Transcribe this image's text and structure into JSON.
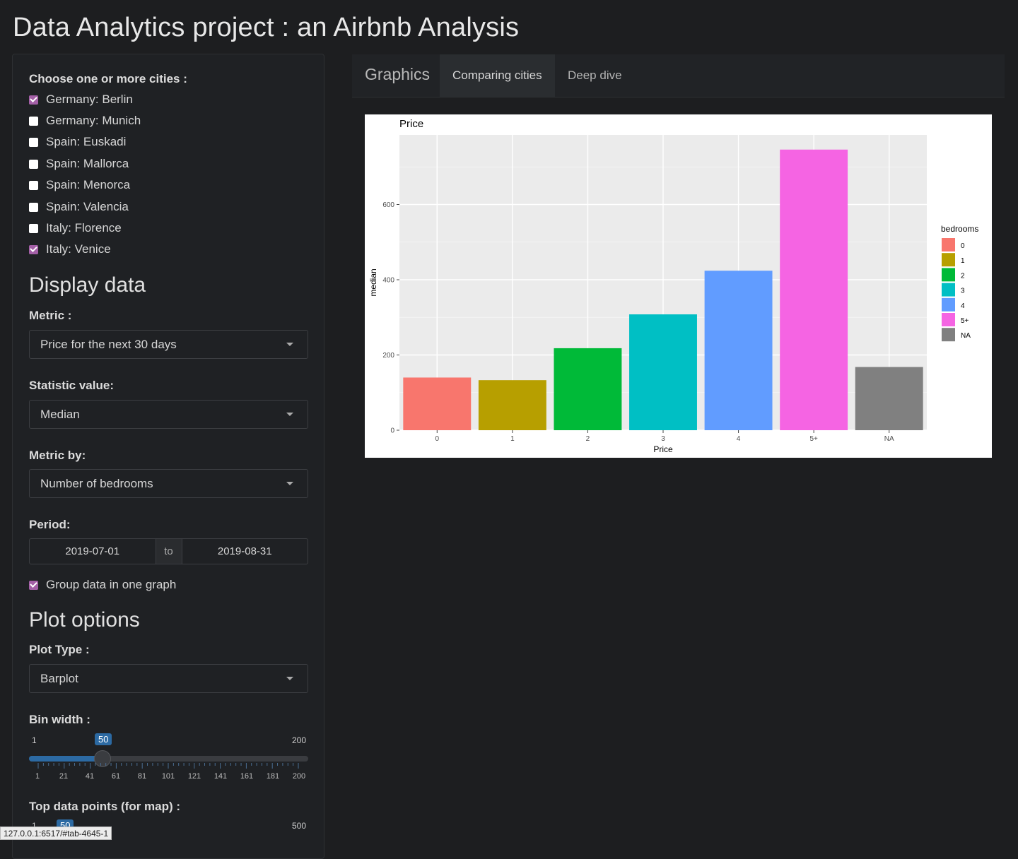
{
  "title": "Data Analytics project : an Airbnb Analysis",
  "sidebar": {
    "cities_label": "Choose one or more cities :",
    "cities": [
      {
        "label": "Germany: Berlin",
        "checked": true
      },
      {
        "label": "Germany: Munich",
        "checked": false
      },
      {
        "label": "Spain: Euskadi",
        "checked": false
      },
      {
        "label": "Spain: Mallorca",
        "checked": false
      },
      {
        "label": "Spain: Menorca",
        "checked": false
      },
      {
        "label": "Spain: Valencia",
        "checked": false
      },
      {
        "label": "Italy: Florence",
        "checked": false
      },
      {
        "label": "Italy: Venice",
        "checked": true
      }
    ],
    "display_heading": "Display data",
    "metric_label": "Metric :",
    "metric_value": "Price for the next 30 days",
    "statistic_label": "Statistic value:",
    "statistic_value": "Median",
    "metric_by_label": "Metric by:",
    "metric_by_value": "Number of bedrooms",
    "period_label": "Period:",
    "period_start": "2019-07-01",
    "period_sep": "to",
    "period_end": "2019-08-31",
    "group_label": "Group data in one graph",
    "group_checked": true,
    "plot_heading": "Plot options",
    "plot_type_label": "Plot Type :",
    "plot_type_value": "Barplot",
    "bin_label": "Bin width :",
    "bin_min": "1",
    "bin_max": "200",
    "bin_value": "50",
    "bin_value_num": 50,
    "bin_ticks": [
      "1",
      "21",
      "41",
      "61",
      "81",
      "101",
      "121",
      "141",
      "161",
      "181",
      "200"
    ],
    "top_label": "Top data points (for map) :",
    "top_min": "1",
    "top_value": "50",
    "top_max": "500"
  },
  "tabs": {
    "brand": "Graphics",
    "items": [
      "Comparing cities",
      "Deep dive"
    ],
    "active": 0
  },
  "status_url": "127.0.0.1:6517/#tab-4645-1",
  "colors": {
    "accent": "#a35fa6",
    "slider": "#2c6aa3"
  },
  "chart_data": {
    "type": "bar",
    "title": "Price",
    "xlabel": "Price",
    "ylabel": "median",
    "categories": [
      "0",
      "1",
      "2",
      "3",
      "4",
      "5+",
      "NA"
    ],
    "values": [
      140,
      133,
      218,
      308,
      424,
      746,
      168
    ],
    "colors": [
      "#F8766D",
      "#B79F00",
      "#00BA38",
      "#00BFC4",
      "#619CFF",
      "#F564E3",
      "#808080"
    ],
    "ylim": [
      0,
      785
    ],
    "yticks": [
      0,
      200,
      400,
      600
    ],
    "legend_title": "bedrooms",
    "legend_position": "right",
    "grid": true
  }
}
